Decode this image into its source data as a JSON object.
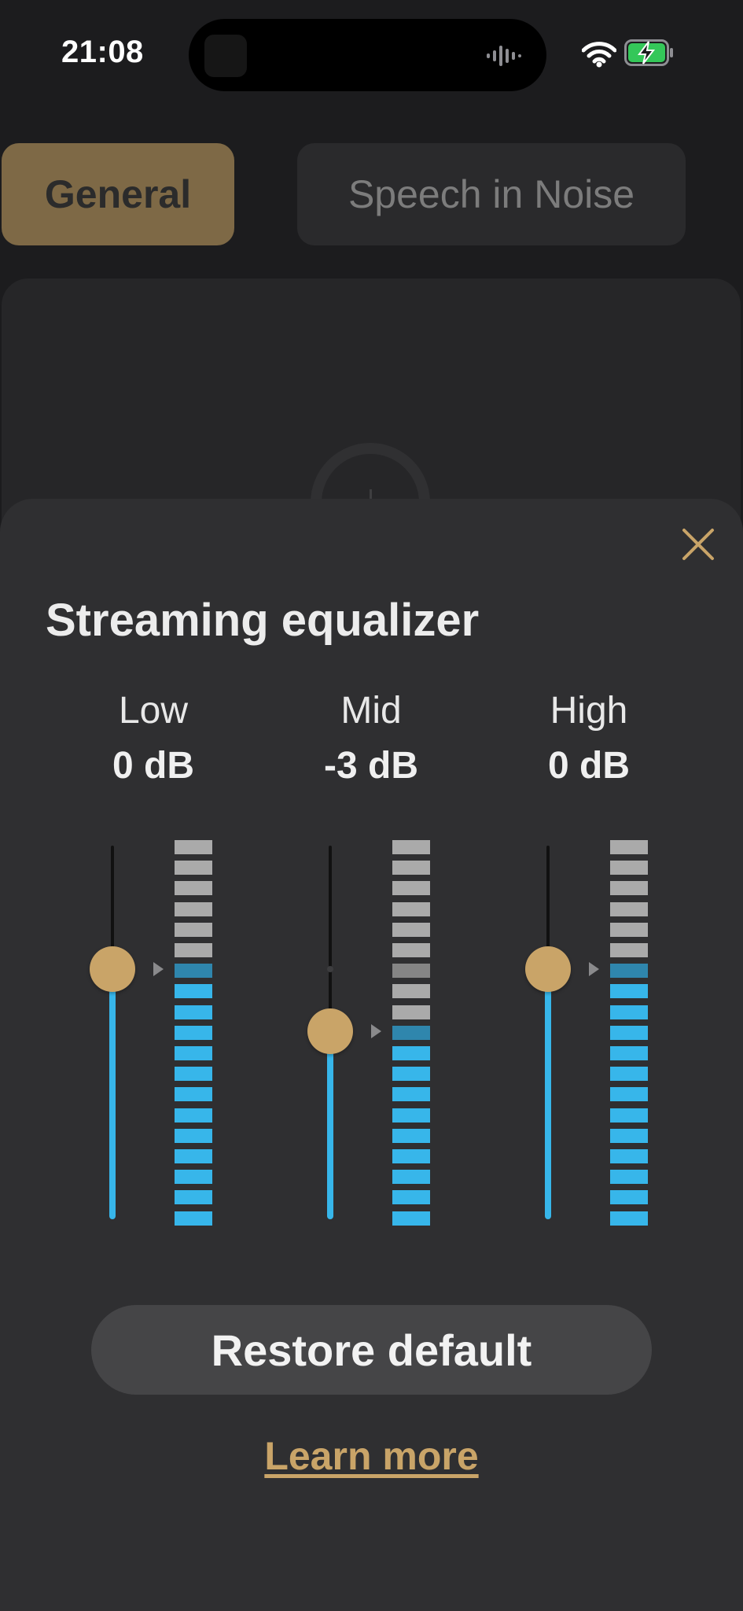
{
  "status_bar": {
    "time": "21:08",
    "icons": [
      "dynamic-island",
      "wifi-icon",
      "battery-charging-icon"
    ]
  },
  "background": {
    "tabs": [
      {
        "label": "General",
        "selected": true
      },
      {
        "label": "Speech in Noise",
        "selected": false
      }
    ]
  },
  "sheet": {
    "title": "Streaming equalizer",
    "close_icon": "close-icon",
    "bands": [
      {
        "name": "Low",
        "value_label": "0 dB",
        "value_db": 0
      },
      {
        "name": "Mid",
        "value_label": "-3 dB",
        "value_db": -3
      },
      {
        "name": "High",
        "value_label": "0 dB",
        "value_db": 0
      }
    ],
    "restore_label": "Restore default",
    "learn_more_label": "Learn more"
  },
  "colors": {
    "accent": "#c9a468",
    "meter_active": "#37b6ea",
    "meter_inactive": "#aaaaaa",
    "sheet_bg": "#2f2f31"
  }
}
